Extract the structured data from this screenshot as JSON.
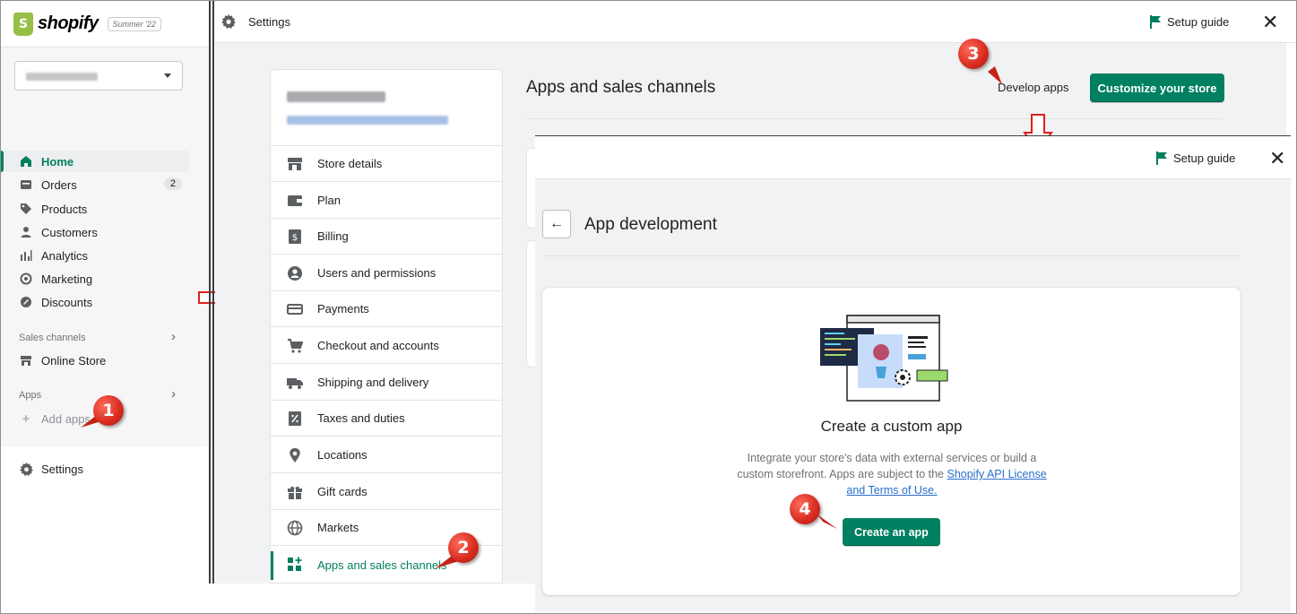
{
  "admin": {
    "brand": "shopify",
    "edition_badge": "Summer '22",
    "nav": [
      {
        "label": "Home",
        "icon": "home-icon",
        "active": true
      },
      {
        "label": "Orders",
        "icon": "orders-icon",
        "badge": "2"
      },
      {
        "label": "Products",
        "icon": "tag-icon"
      },
      {
        "label": "Customers",
        "icon": "person-icon"
      },
      {
        "label": "Analytics",
        "icon": "bar-chart-icon"
      },
      {
        "label": "Marketing",
        "icon": "target-icon"
      },
      {
        "label": "Discounts",
        "icon": "discount-icon"
      }
    ],
    "sales_channels_label": "Sales channels",
    "online_store_label": "Online Store",
    "apps_label": "Apps",
    "add_apps_label": "Add apps",
    "settings_label": "Settings"
  },
  "settings_bar": {
    "title": "Settings",
    "setup_guide": "Setup guide"
  },
  "settings_menu": [
    {
      "label": "Store details",
      "icon": "store-icon"
    },
    {
      "label": "Plan",
      "icon": "plan-icon"
    },
    {
      "label": "Billing",
      "icon": "billing-icon"
    },
    {
      "label": "Users and permissions",
      "icon": "user-circle-icon"
    },
    {
      "label": "Payments",
      "icon": "payments-icon"
    },
    {
      "label": "Checkout and accounts",
      "icon": "cart-icon"
    },
    {
      "label": "Shipping and delivery",
      "icon": "truck-icon"
    },
    {
      "label": "Taxes and duties",
      "icon": "tax-icon"
    },
    {
      "label": "Locations",
      "icon": "location-pin-icon"
    },
    {
      "label": "Gift cards",
      "icon": "gift-icon"
    },
    {
      "label": "Markets",
      "icon": "globe-icon"
    },
    {
      "label": "Apps and sales channels",
      "icon": "apps-grid-icon",
      "active": true
    }
  ],
  "apps_page": {
    "title": "Apps and sales channels",
    "develop_apps": "Develop apps",
    "customize_store": "Customize your store"
  },
  "overlay": {
    "setup_guide": "Setup guide",
    "title": "App development",
    "card_title": "Create a custom app",
    "card_desc_prefix": "Integrate your store's data with external services or build a custom storefront. Apps are subject to the ",
    "card_link": "Shopify API License and Terms of Use.",
    "create_button": "Create an app"
  },
  "annotations": {
    "step1": "1",
    "step2": "2",
    "step3": "3",
    "step4": "4"
  },
  "colors": {
    "accent_green": "#008060",
    "marker_red": "#d62a1e",
    "arrow_red": "#e02020",
    "link_blue": "#2c6ecb"
  }
}
